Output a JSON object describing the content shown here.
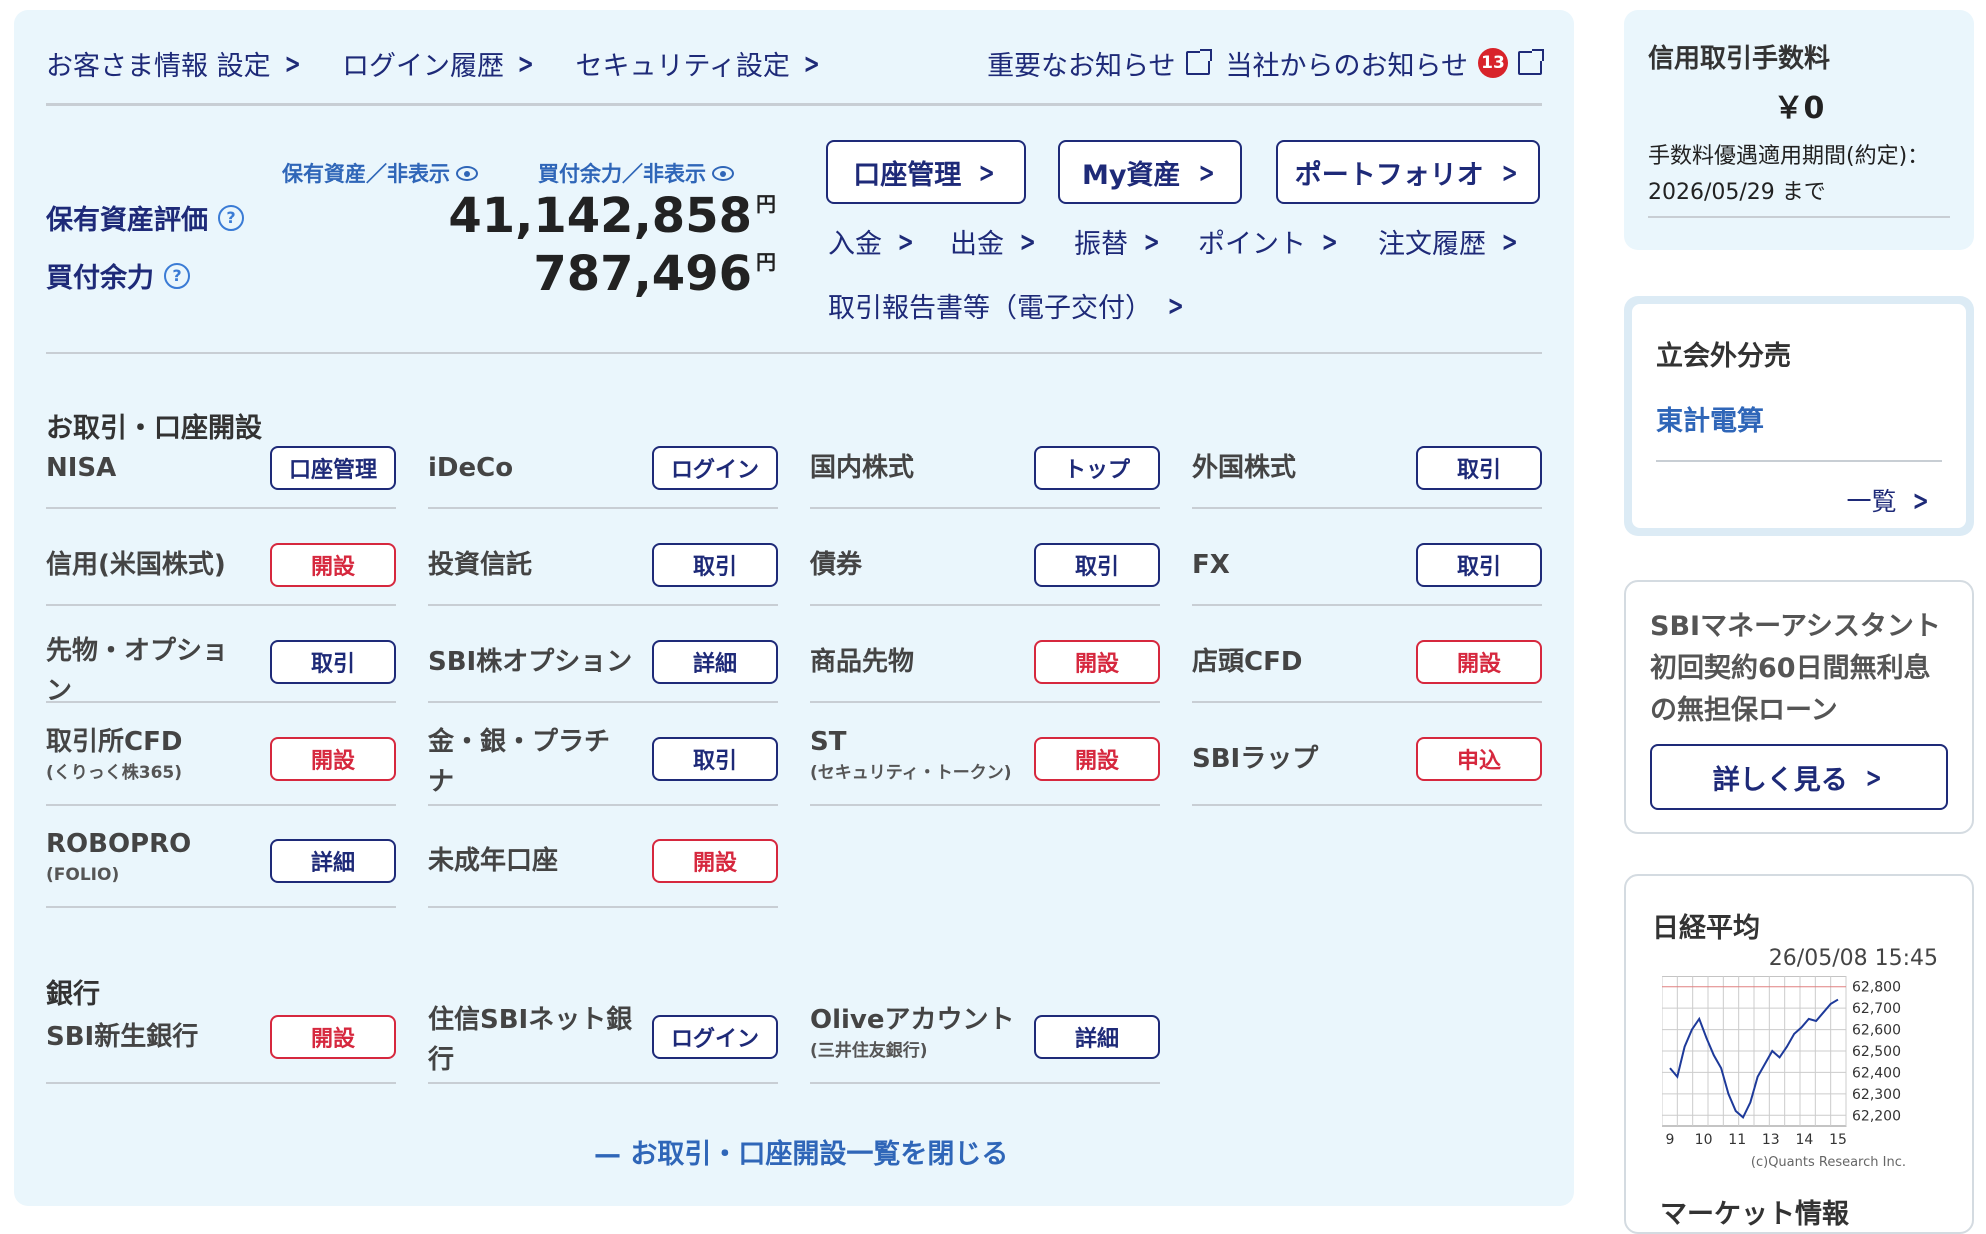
{
  "topnav": {
    "left": [
      "お客さま情報 設定",
      "ログイン履歴",
      "セキュリティ設定"
    ],
    "right": [
      {
        "label": "重要なお知らせ",
        "badge": ""
      },
      {
        "label": "当社からのお知らせ",
        "badge": "13"
      }
    ]
  },
  "assets": {
    "toggle_holdings": "保有資産／非表示",
    "toggle_buying": "買付余力／非表示",
    "valuation_label": "保有資産評価",
    "valuation_value": "41,142,858",
    "buying_label": "買付余力",
    "buying_value": "787,496",
    "yen": "円"
  },
  "buttons": {
    "account": "口座管理",
    "my_assets": "My資産",
    "portfolio": "ポートフォリオ"
  },
  "quicklinks": {
    "deposit": "入金",
    "withdraw": "出金",
    "transfer": "振替",
    "points": "ポイント",
    "orders": "注文履歴",
    "reports": "取引報告書等（電子交付）"
  },
  "trade_section": {
    "title": "お取引・口座開設",
    "items": [
      {
        "name": "NISA",
        "sub": "",
        "btn": "口座管理"
      },
      {
        "name": "iDeCo",
        "sub": "",
        "btn": "ログイン"
      },
      {
        "name": "国内株式",
        "sub": "",
        "btn": "トップ"
      },
      {
        "name": "外国株式",
        "sub": "",
        "btn": "取引"
      },
      {
        "name": "信用(米国株式)",
        "sub": "",
        "btn": "開設"
      },
      {
        "name": "投資信託",
        "sub": "",
        "btn": "取引"
      },
      {
        "name": "債券",
        "sub": "",
        "btn": "取引"
      },
      {
        "name": "FX",
        "sub": "",
        "btn": "取引"
      },
      {
        "name": "先物・オプショ",
        "name2": "ン",
        "sub": "",
        "btn": "取引"
      },
      {
        "name": "SBI株オプション",
        "sub": "",
        "btn": "詳細"
      },
      {
        "name": "商品先物",
        "sub": "",
        "btn": "開設"
      },
      {
        "name": "店頭CFD",
        "sub": "",
        "btn": "開設"
      },
      {
        "name": "取引所CFD",
        "sub": "(くりっく株365)",
        "btn": "開設"
      },
      {
        "name": "金・銀・プラチ",
        "name2": "ナ",
        "sub": "",
        "btn": "取引"
      },
      {
        "name": "ST",
        "sub": "(セキュリティ・トークン)",
        "btn": "開設"
      },
      {
        "name": "SBIラップ",
        "sub": "",
        "btn": "申込"
      },
      {
        "name": "ROBOPRO",
        "sub": "(FOLIO)",
        "btn": "詳細"
      },
      {
        "name": "未成年口座",
        "sub": "",
        "btn": "開設"
      }
    ]
  },
  "bank_section": {
    "title": "銀行",
    "items": [
      {
        "name": "SBI新生銀行",
        "sub": "",
        "btn": "開設"
      },
      {
        "name": "住信SBIネット銀",
        "name2": "行",
        "sub": "",
        "btn": "ログイン"
      },
      {
        "name": "Oliveアカウント",
        "sub": "(三井住友銀行)",
        "btn": "詳細"
      }
    ]
  },
  "close_link": "— お取引・口座開設一覧を閉じる",
  "sidebar": {
    "fee_title": "信用取引手数料",
    "fee_value": "￥0",
    "fee_period_label": "手数料優遇適用期間(約定)：",
    "fee_period_value": "2026/05/29 まで",
    "hours_title": "立会外分売",
    "hours_item": "東計電算",
    "hours_more": "一覧",
    "promo_text": "SBIマネーアシスタント初回契約60日間無利息の無担保ローン",
    "promo_btn": "詳しく見る",
    "nikkei_title": "日経平均",
    "nikkei_time": "26/05/08 15:45",
    "nikkei_credit": "(c)Quants Research Inc.",
    "market_title": "マーケット情報"
  },
  "chart_data": {
    "type": "line",
    "title": "日経平均",
    "x_ticks": [
      "9",
      "10",
      "11",
      "13",
      "14",
      "15"
    ],
    "y_ticks": [
      62800,
      62700,
      62600,
      62500,
      62400,
      62300,
      62200
    ],
    "ylim": [
      62150,
      62850
    ],
    "values": [
      62420,
      62380,
      62520,
      62600,
      62650,
      62560,
      62480,
      62420,
      62300,
      62220,
      62190,
      62260,
      62380,
      62440,
      62500,
      62470,
      62520,
      62580,
      62610,
      62650,
      62640,
      62680,
      62720,
      62740
    ]
  },
  "colors": {
    "navy": "#1e2a78",
    "red": "#d6283e",
    "link": "#2f66b8",
    "bg": "#eaf6fc"
  }
}
